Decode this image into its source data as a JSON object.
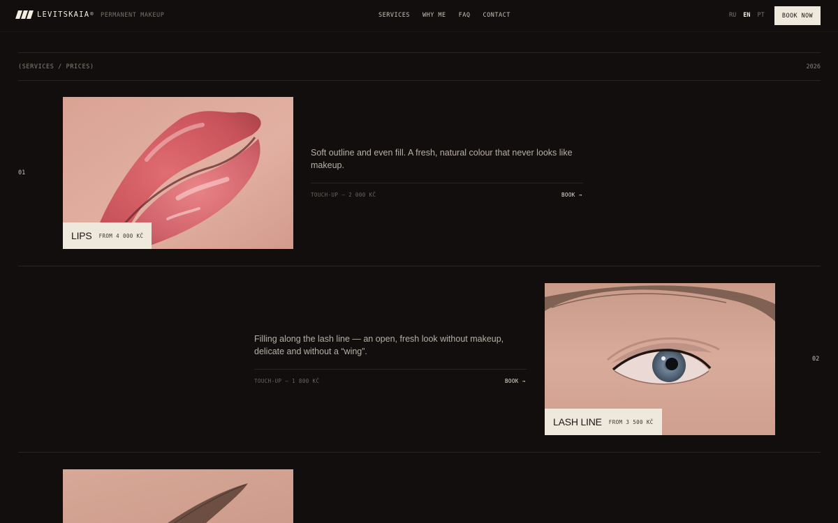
{
  "header": {
    "brand_name": "LEVITSKAIA",
    "brand_mark": "®",
    "tagline": "PERMANENT MAKEUP",
    "nav": [
      "SERVICES",
      "WHY ME",
      "FAQ",
      "CONTACT"
    ],
    "languages": [
      "RU",
      "EN",
      "PT"
    ],
    "active_language": "EN",
    "book_now": "BOOK NOW"
  },
  "section": {
    "breadcrumb": "(SERVICES / PRICES)",
    "year": "2026"
  },
  "services": [
    {
      "index": "01",
      "name": "LIPS",
      "price": "FROM 4 000 KČ",
      "description": "Soft outline and even fill. A fresh, natural colour that never looks like makeup.",
      "touchup": "TOUCH-UP — 2 000 KČ",
      "book": "BOOK →"
    },
    {
      "index": "02",
      "name": "LASH LINE",
      "price": "FROM 3 500 KČ",
      "description": "Filling along the lash line — an open, fresh look without makeup, delicate and without a “wing”.",
      "touchup": "TOUCH-UP — 1 800 KČ",
      "book": "BOOK →"
    }
  ],
  "colors": {
    "background": "#110e0d",
    "cream": "#efe8dc",
    "muted": "#7b736a"
  }
}
